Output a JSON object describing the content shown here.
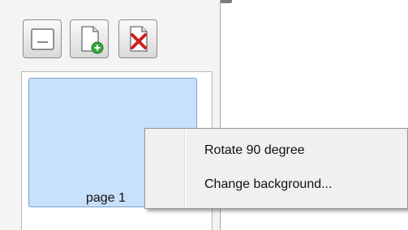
{
  "toolbar": {
    "buttons": [
      {
        "name": "blank-page-button",
        "icon": "blank-page-icon"
      },
      {
        "name": "add-page-button",
        "icon": "add-page-icon"
      },
      {
        "name": "delete-page-button",
        "icon": "delete-page-icon"
      }
    ]
  },
  "pages": [
    {
      "label": "page 1",
      "selected": true
    }
  ],
  "context_menu": {
    "items": [
      {
        "label": "Rotate 90 degree"
      },
      {
        "label": "Change background..."
      }
    ]
  },
  "colors": {
    "selection": "#c7e0fb",
    "add_accent": "#3aa63a",
    "delete_accent": "#d02020"
  }
}
